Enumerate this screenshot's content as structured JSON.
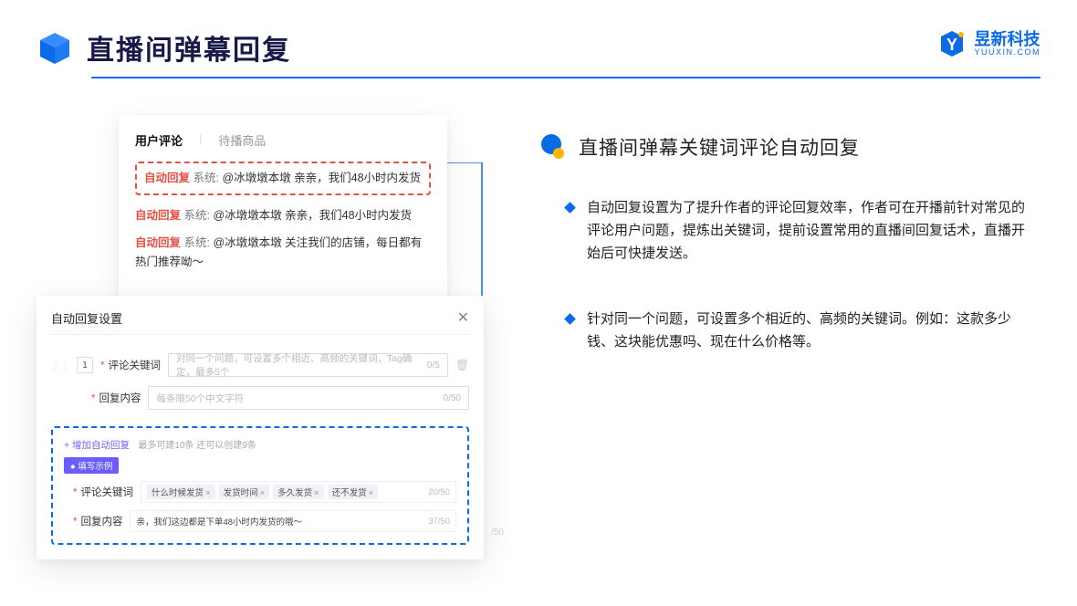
{
  "header": {
    "title": "直播间弹幕回复"
  },
  "brand": {
    "name": "昱新科技",
    "sub": "YUUXIN.COM"
  },
  "card1": {
    "tab_active": "用户评论",
    "tab_inactive": "待播商品",
    "reply_tag": "自动回复",
    "sys_label": "系统:",
    "line1": "@冰墩墩本墩 亲亲，我们48小时内发货",
    "line2": "@冰墩墩本墩 亲亲，我们48小时内发货",
    "line3": "@冰墩墩本墩 关注我们的店铺，每日都有热门推荐呦～"
  },
  "card2": {
    "modal_title": "自动回复设置",
    "order_num": "1",
    "label_kw": "评论关键词",
    "placeholder_kw": "对同一个问题，可设置多个相近、高频的关键词，Tag确定，最多5个",
    "count_kw": "0/5",
    "label_content": "回复内容",
    "placeholder_content": "每条限50个中文字符",
    "count_content": "0/50",
    "add_text": "+ 增加自动回复",
    "add_hint": "最多可建10条 还可以创建9条",
    "chip_badge": "● 填写示例",
    "ex_label_kw": "评论关键词",
    "chip1": "什么时候发货",
    "chip2": "发货时间",
    "chip3": "多久发货",
    "chip4": "还不发货",
    "ex_kw_count": "20/50",
    "ex_label_ct": "回复内容",
    "ex_ct_value": "亲，我们这边都是下单48小时内发货的哦～",
    "ex_ct_count": "37/50",
    "stray": "/50"
  },
  "right": {
    "section_title": "直播间弹幕关键词评论自动回复",
    "bullet1": "自动回复设置为了提升作者的评论回复效率，作者可在开播前针对常见的评论用户问题，提炼出关键词，提前设置常用的直播间回复话术，直播开始后可快捷发送。",
    "bullet2": "针对同一个问题，可设置多个相近的、高频的关键词。例如：这款多少钱、这块能优惠吗、现在什么价格等。"
  }
}
